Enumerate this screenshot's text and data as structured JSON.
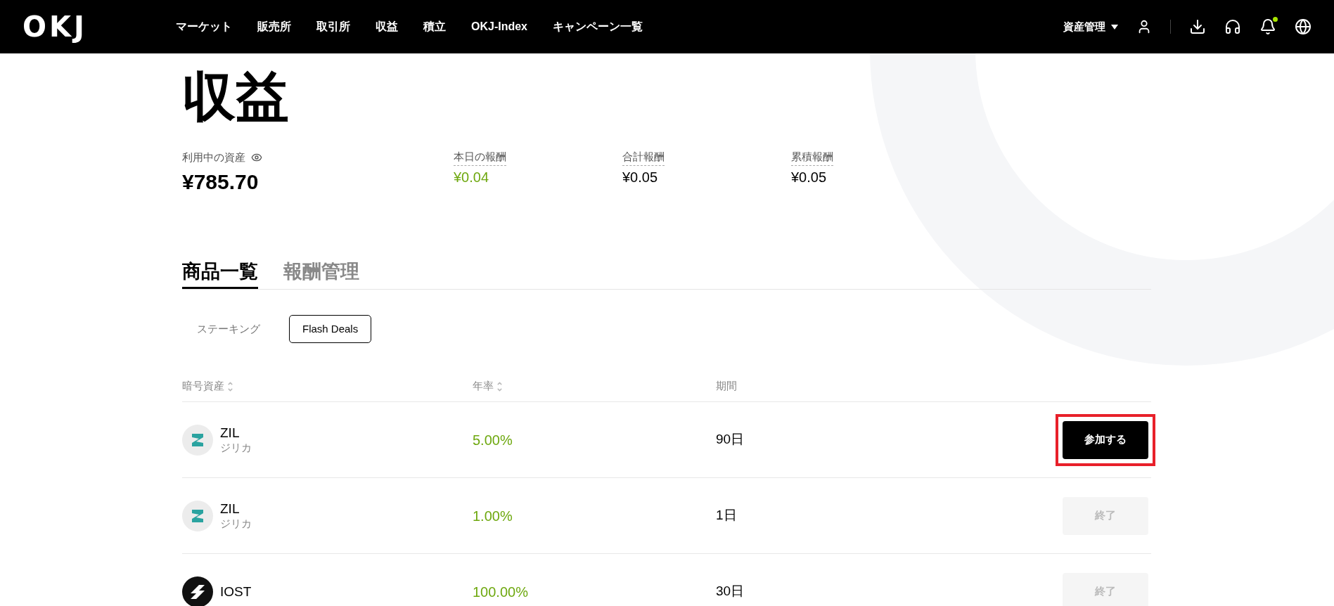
{
  "header": {
    "logo": "OKJ",
    "nav": [
      "マーケット",
      "販売所",
      "取引所",
      "収益",
      "積立",
      "OKJ-Index",
      "キャンペーン一覧"
    ],
    "asset_menu": "資産管理",
    "notification_dot": true
  },
  "page_title": "収益",
  "stats": [
    {
      "label": "利用中の資産",
      "value": "¥785.70",
      "kind": "main"
    },
    {
      "label": "本日の報酬",
      "value": "¥0.04",
      "kind": "green"
    },
    {
      "label": "合計報酬",
      "value": "¥0.05",
      "kind": "plain"
    },
    {
      "label": "累積報酬",
      "value": "¥0.05",
      "kind": "plain"
    }
  ],
  "tabs": [
    {
      "label": "商品一覧",
      "selected": true
    },
    {
      "label": "報酬管理",
      "selected": false
    }
  ],
  "filters": [
    {
      "label": "ステーキング",
      "selected": false
    },
    {
      "label": "Flash Deals",
      "selected": true
    }
  ],
  "table": {
    "columns": [
      {
        "label": "暗号資産",
        "sortable": true
      },
      {
        "label": "年率",
        "sortable": true
      },
      {
        "label": "期間",
        "sortable": false
      }
    ],
    "rows": [
      {
        "coin": "ZIL",
        "name": "ジリカ",
        "kind": "zil",
        "rate": "5.00%",
        "term": "90日",
        "button": "参加する",
        "disabled": false,
        "highlighted": true
      },
      {
        "coin": "ZIL",
        "name": "ジリカ",
        "kind": "zil",
        "rate": "1.00%",
        "term": "1日",
        "button": "終了",
        "disabled": true,
        "highlighted": false
      },
      {
        "coin": "IOST",
        "kind": "iost",
        "rate": "100.00%",
        "term": "30日",
        "button": "終了",
        "disabled": true,
        "highlighted": false
      }
    ]
  }
}
